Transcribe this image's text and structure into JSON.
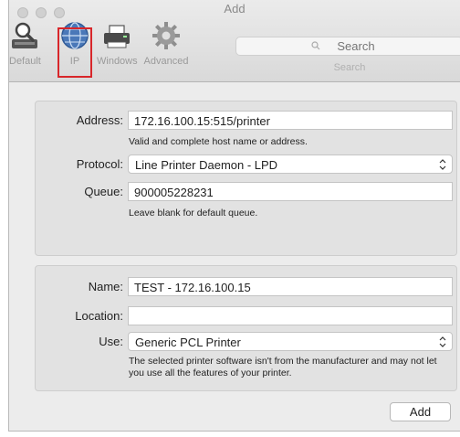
{
  "window": {
    "title": "Add"
  },
  "toolbar": {
    "tools": [
      {
        "id": "default",
        "label": "Default",
        "icon": "magnifier-printer-icon"
      },
      {
        "id": "ip",
        "label": "IP",
        "icon": "globe-icon",
        "selected": true
      },
      {
        "id": "windows",
        "label": "Windows",
        "icon": "printer-icon"
      },
      {
        "id": "advanced",
        "label": "Advanced",
        "icon": "gear-icon"
      }
    ],
    "search": {
      "placeholder": "Search",
      "label": "Search"
    }
  },
  "printer_panel": {
    "address_label": "Address:",
    "address_value": "172.16.100.15:515/printer",
    "address_hint": "Valid and complete host name or address.",
    "protocol_label": "Protocol:",
    "protocol_value": "Line Printer Daemon - LPD",
    "queue_label": "Queue:",
    "queue_value": "900005228231",
    "queue_hint": "Leave blank for default queue."
  },
  "details_panel": {
    "name_label": "Name:",
    "name_value": "TEST - 172.16.100.15",
    "location_label": "Location:",
    "location_value": "",
    "use_label": "Use:",
    "use_value": "Generic PCL Printer",
    "use_hint": "The selected printer software isn't from the manufacturer and may not let you use all the features of your printer."
  },
  "footer": {
    "add_label": "Add"
  },
  "colors": {
    "highlight": "#d8262a",
    "globe": "#4a78b8"
  }
}
